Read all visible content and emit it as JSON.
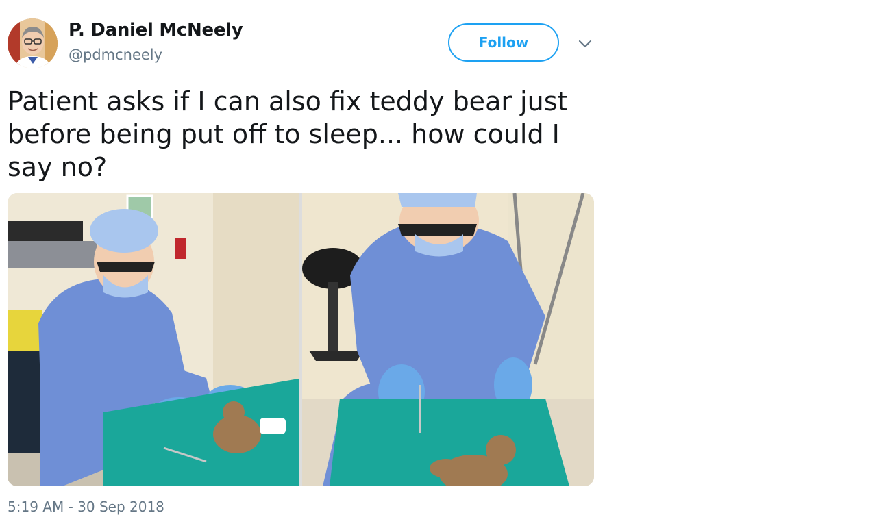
{
  "author": {
    "name": "P. Daniel McNeely",
    "handle": "@pdmcneely"
  },
  "follow_button": {
    "label": "Follow"
  },
  "tweet": {
    "text": "Patient asks if I can also fix teddy bear just before being put off to sleep... how could I say no?",
    "timestamp": "5:19 AM - 30 Sep 2018"
  },
  "media": {
    "count": 2
  },
  "colors": {
    "accent": "#1da1f2",
    "text": "#14171a",
    "secondary_text": "#657786",
    "scrubs": "#6f8fd6",
    "drape": "#1aa79a",
    "glove": "#6aa9e8"
  },
  "icons": {
    "menu": "chevron-down-icon"
  }
}
